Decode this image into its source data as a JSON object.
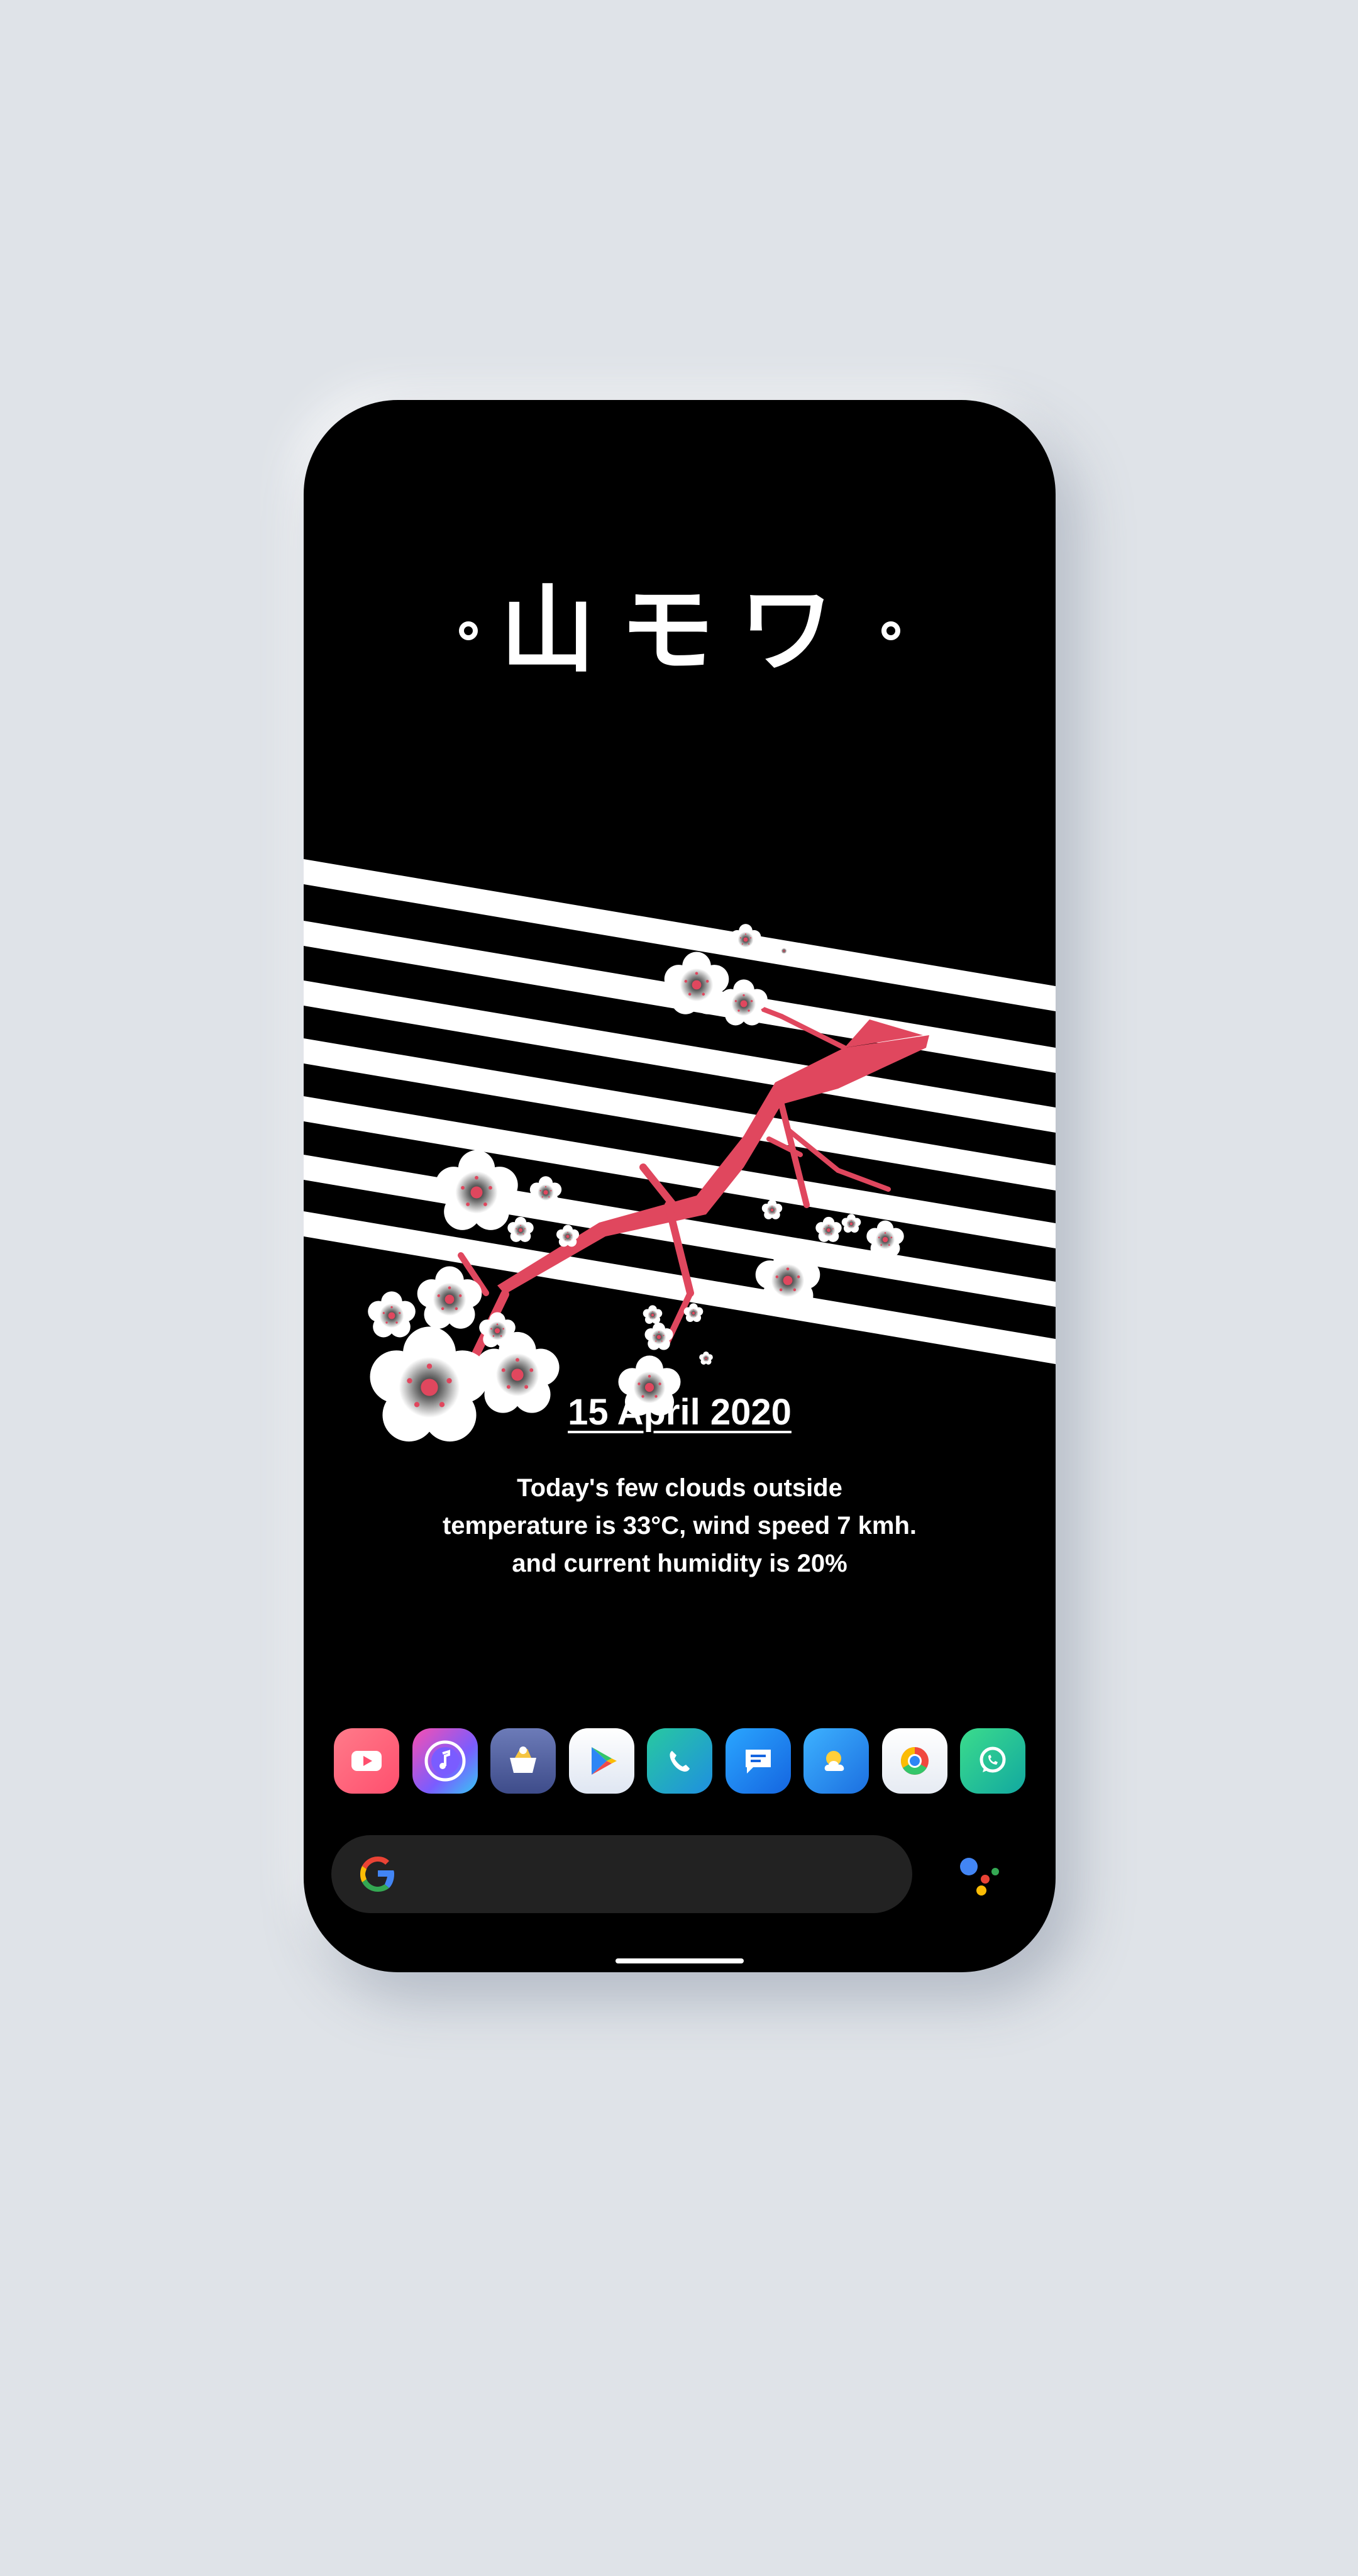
{
  "home": {
    "title": "山モワ",
    "date": "15 April 2020",
    "weather": {
      "line1": "Today's few clouds outside",
      "line2": "temperature is 33°C, wind speed 7 kmh.",
      "line3": "and current humidity is 20%"
    }
  },
  "dock": {
    "apps": [
      {
        "icon": "youtube-icon"
      },
      {
        "icon": "music-icon"
      },
      {
        "icon": "shop-icon"
      },
      {
        "icon": "play-store-icon"
      },
      {
        "icon": "phone-icon"
      },
      {
        "icon": "messages-icon"
      },
      {
        "icon": "weather-icon"
      },
      {
        "icon": "chrome-icon"
      },
      {
        "icon": "whatsapp-icon"
      }
    ]
  },
  "search": {
    "icon": "google-icon",
    "assistant_icon": "google-assistant-icon"
  },
  "colors": {
    "background": "#dfe3e8",
    "screen": "#000000",
    "accent": "#e0475e",
    "stripes": "#ffffff",
    "search_bar": "#222222"
  }
}
